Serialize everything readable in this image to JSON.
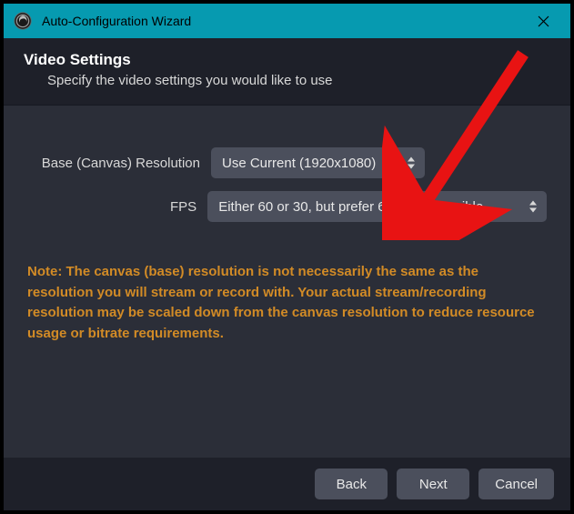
{
  "titlebar": {
    "title": "Auto-Configuration Wizard"
  },
  "header": {
    "title": "Video Settings",
    "subtitle": "Specify the video settings you would like to use"
  },
  "form": {
    "canvas_label": "Base (Canvas) Resolution",
    "canvas_value": "Use Current (1920x1080)",
    "fps_label": "FPS",
    "fps_value": "Either 60 or 30, but prefer 60 when possible"
  },
  "note": "Note: The canvas (base) resolution is not necessarily the same as the resolution you will stream or record with. Your actual stream/recording resolution may be scaled down from the canvas resolution to reduce resource usage or bitrate requirements.",
  "footer": {
    "back": "Back",
    "next": "Next",
    "cancel": "Cancel"
  }
}
